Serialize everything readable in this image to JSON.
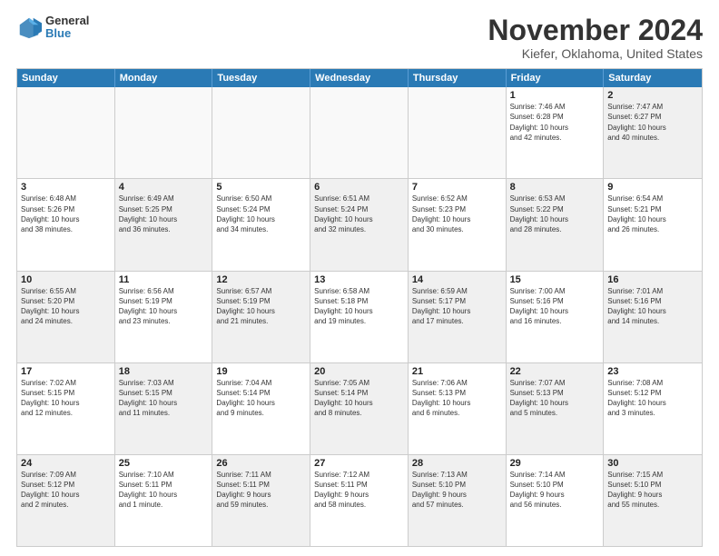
{
  "logo": {
    "general": "General",
    "blue": "Blue"
  },
  "header": {
    "title": "November 2024",
    "subtitle": "Kiefer, Oklahoma, United States"
  },
  "weekdays": [
    "Sunday",
    "Monday",
    "Tuesday",
    "Wednesday",
    "Thursday",
    "Friday",
    "Saturday"
  ],
  "rows": [
    [
      {
        "day": "",
        "info": "",
        "empty": true
      },
      {
        "day": "",
        "info": "",
        "empty": true
      },
      {
        "day": "",
        "info": "",
        "empty": true
      },
      {
        "day": "",
        "info": "",
        "empty": true
      },
      {
        "day": "",
        "info": "",
        "empty": true
      },
      {
        "day": "1",
        "info": "Sunrise: 7:46 AM\nSunset: 6:28 PM\nDaylight: 10 hours\nand 42 minutes."
      },
      {
        "day": "2",
        "info": "Sunrise: 7:47 AM\nSunset: 6:27 PM\nDaylight: 10 hours\nand 40 minutes.",
        "shaded": true
      }
    ],
    [
      {
        "day": "3",
        "info": "Sunrise: 6:48 AM\nSunset: 5:26 PM\nDaylight: 10 hours\nand 38 minutes."
      },
      {
        "day": "4",
        "info": "Sunrise: 6:49 AM\nSunset: 5:25 PM\nDaylight: 10 hours\nand 36 minutes.",
        "shaded": true
      },
      {
        "day": "5",
        "info": "Sunrise: 6:50 AM\nSunset: 5:24 PM\nDaylight: 10 hours\nand 34 minutes."
      },
      {
        "day": "6",
        "info": "Sunrise: 6:51 AM\nSunset: 5:24 PM\nDaylight: 10 hours\nand 32 minutes.",
        "shaded": true
      },
      {
        "day": "7",
        "info": "Sunrise: 6:52 AM\nSunset: 5:23 PM\nDaylight: 10 hours\nand 30 minutes."
      },
      {
        "day": "8",
        "info": "Sunrise: 6:53 AM\nSunset: 5:22 PM\nDaylight: 10 hours\nand 28 minutes.",
        "shaded": true
      },
      {
        "day": "9",
        "info": "Sunrise: 6:54 AM\nSunset: 5:21 PM\nDaylight: 10 hours\nand 26 minutes."
      }
    ],
    [
      {
        "day": "10",
        "info": "Sunrise: 6:55 AM\nSunset: 5:20 PM\nDaylight: 10 hours\nand 24 minutes.",
        "shaded": true
      },
      {
        "day": "11",
        "info": "Sunrise: 6:56 AM\nSunset: 5:19 PM\nDaylight: 10 hours\nand 23 minutes."
      },
      {
        "day": "12",
        "info": "Sunrise: 6:57 AM\nSunset: 5:19 PM\nDaylight: 10 hours\nand 21 minutes.",
        "shaded": true
      },
      {
        "day": "13",
        "info": "Sunrise: 6:58 AM\nSunset: 5:18 PM\nDaylight: 10 hours\nand 19 minutes."
      },
      {
        "day": "14",
        "info": "Sunrise: 6:59 AM\nSunset: 5:17 PM\nDaylight: 10 hours\nand 17 minutes.",
        "shaded": true
      },
      {
        "day": "15",
        "info": "Sunrise: 7:00 AM\nSunset: 5:16 PM\nDaylight: 10 hours\nand 16 minutes."
      },
      {
        "day": "16",
        "info": "Sunrise: 7:01 AM\nSunset: 5:16 PM\nDaylight: 10 hours\nand 14 minutes.",
        "shaded": true
      }
    ],
    [
      {
        "day": "17",
        "info": "Sunrise: 7:02 AM\nSunset: 5:15 PM\nDaylight: 10 hours\nand 12 minutes."
      },
      {
        "day": "18",
        "info": "Sunrise: 7:03 AM\nSunset: 5:15 PM\nDaylight: 10 hours\nand 11 minutes.",
        "shaded": true
      },
      {
        "day": "19",
        "info": "Sunrise: 7:04 AM\nSunset: 5:14 PM\nDaylight: 10 hours\nand 9 minutes."
      },
      {
        "day": "20",
        "info": "Sunrise: 7:05 AM\nSunset: 5:14 PM\nDaylight: 10 hours\nand 8 minutes.",
        "shaded": true
      },
      {
        "day": "21",
        "info": "Sunrise: 7:06 AM\nSunset: 5:13 PM\nDaylight: 10 hours\nand 6 minutes."
      },
      {
        "day": "22",
        "info": "Sunrise: 7:07 AM\nSunset: 5:13 PM\nDaylight: 10 hours\nand 5 minutes.",
        "shaded": true
      },
      {
        "day": "23",
        "info": "Sunrise: 7:08 AM\nSunset: 5:12 PM\nDaylight: 10 hours\nand 3 minutes."
      }
    ],
    [
      {
        "day": "24",
        "info": "Sunrise: 7:09 AM\nSunset: 5:12 PM\nDaylight: 10 hours\nand 2 minutes.",
        "shaded": true
      },
      {
        "day": "25",
        "info": "Sunrise: 7:10 AM\nSunset: 5:11 PM\nDaylight: 10 hours\nand 1 minute."
      },
      {
        "day": "26",
        "info": "Sunrise: 7:11 AM\nSunset: 5:11 PM\nDaylight: 9 hours\nand 59 minutes.",
        "shaded": true
      },
      {
        "day": "27",
        "info": "Sunrise: 7:12 AM\nSunset: 5:11 PM\nDaylight: 9 hours\nand 58 minutes."
      },
      {
        "day": "28",
        "info": "Sunrise: 7:13 AM\nSunset: 5:10 PM\nDaylight: 9 hours\nand 57 minutes.",
        "shaded": true
      },
      {
        "day": "29",
        "info": "Sunrise: 7:14 AM\nSunset: 5:10 PM\nDaylight: 9 hours\nand 56 minutes."
      },
      {
        "day": "30",
        "info": "Sunrise: 7:15 AM\nSunset: 5:10 PM\nDaylight: 9 hours\nand 55 minutes.",
        "shaded": true
      }
    ]
  ]
}
